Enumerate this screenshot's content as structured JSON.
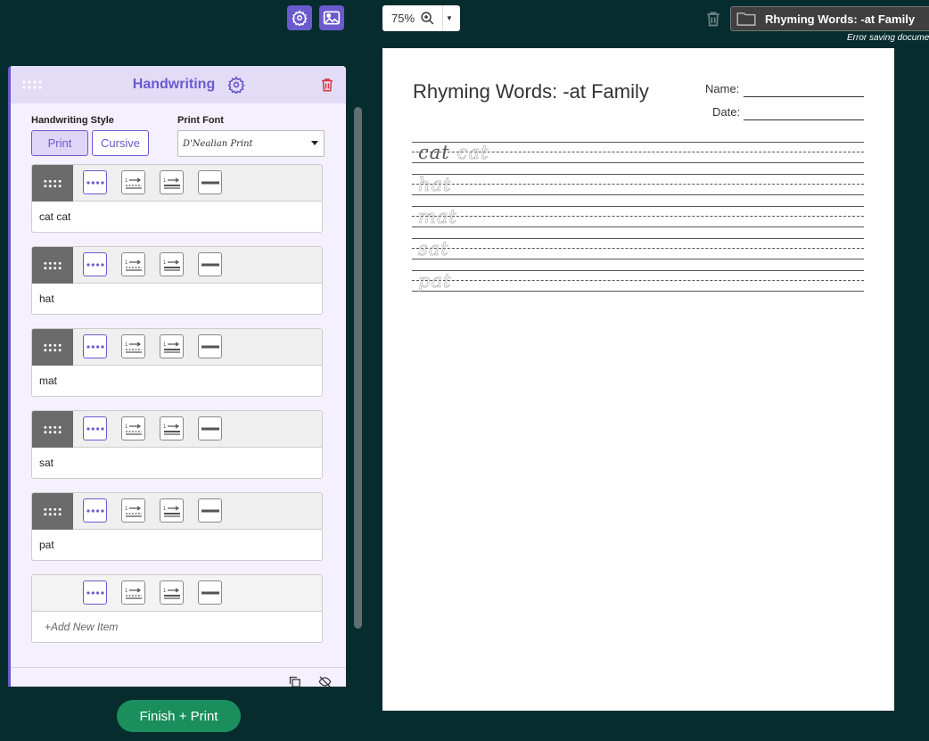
{
  "toolbar": {
    "settings_icon": "gear-icon",
    "image_icon": "image-icon",
    "zoom_value": "75%",
    "zoom_icon": "zoom-in-icon",
    "document_title": "Rhyming Words: -at Family",
    "error_message": "Error saving document"
  },
  "panel": {
    "title": "Handwriting",
    "handwriting_style_label": "Handwriting Style",
    "print_font_label": "Print Font",
    "style_options": [
      "Print",
      "Cursive"
    ],
    "selected_style": "Print",
    "print_font_value": "D'Nealian Print",
    "items": [
      {
        "text": "cat cat"
      },
      {
        "text": "hat"
      },
      {
        "text": "mat"
      },
      {
        "text": "sat"
      },
      {
        "text": "pat"
      }
    ],
    "add_item_placeholder": "+Add New Item"
  },
  "finish_button": "Finish + Print",
  "worksheet": {
    "title": "Rhyming Words: -at Family",
    "name_label": "Name:",
    "date_label": "Date:",
    "rows": [
      {
        "solid": "cat",
        "trace": "cat"
      },
      {
        "solid": "",
        "trace": "hat"
      },
      {
        "solid": "",
        "trace": "mat"
      },
      {
        "solid": "",
        "trace": "sat"
      },
      {
        "solid": "",
        "trace": "pat"
      }
    ]
  },
  "colors": {
    "background": "#062c2e",
    "accent": "#6a5acd",
    "panel_bg": "#f4f0fd",
    "finish_green": "#1a8f5d",
    "delete_red": "#d9363e"
  }
}
